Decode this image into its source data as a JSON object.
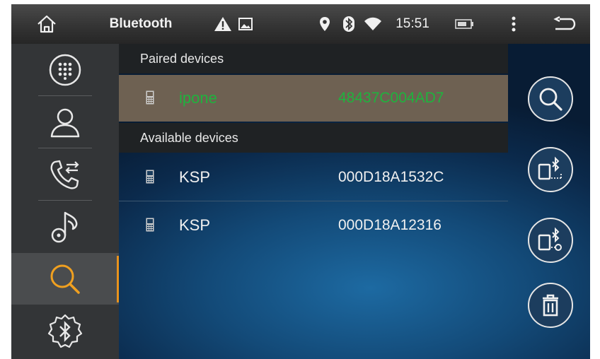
{
  "statusbar": {
    "title": "Bluetooth",
    "time": "15:51",
    "icons": [
      "home-icon",
      "warning-icon",
      "image-icon",
      "location-icon",
      "bluetooth-icon",
      "wifi-icon",
      "battery-icon",
      "menu-icon",
      "back-icon"
    ]
  },
  "sidebar": {
    "items": [
      {
        "name": "dialpad",
        "icon": "dialpad-icon"
      },
      {
        "name": "contacts",
        "icon": "contact-icon"
      },
      {
        "name": "call-log",
        "icon": "call-transfer-icon"
      },
      {
        "name": "music",
        "icon": "music-icon"
      },
      {
        "name": "search",
        "icon": "search-icon",
        "active": true
      },
      {
        "name": "bt-settings",
        "icon": "bluetooth-settings-icon"
      }
    ],
    "accent_color": "#e8921c"
  },
  "sections": {
    "paired_label": "Paired devices",
    "available_label": "Available devices"
  },
  "paired_devices": [
    {
      "name": "ipone",
      "address": "48437C004AD7"
    }
  ],
  "available_devices": [
    {
      "name": "KSP",
      "address": "000D18A1532C"
    },
    {
      "name": "KSP",
      "address": "000D18A12316"
    }
  ],
  "actions": [
    "search-icon",
    "bluetooth-phone-connect-icon",
    "bluetooth-phone-disconnect-icon",
    "trash-icon"
  ],
  "colors": {
    "paired_text": "#1fb33e",
    "paired_row": "#6e6152",
    "accent": "#e8921c"
  }
}
